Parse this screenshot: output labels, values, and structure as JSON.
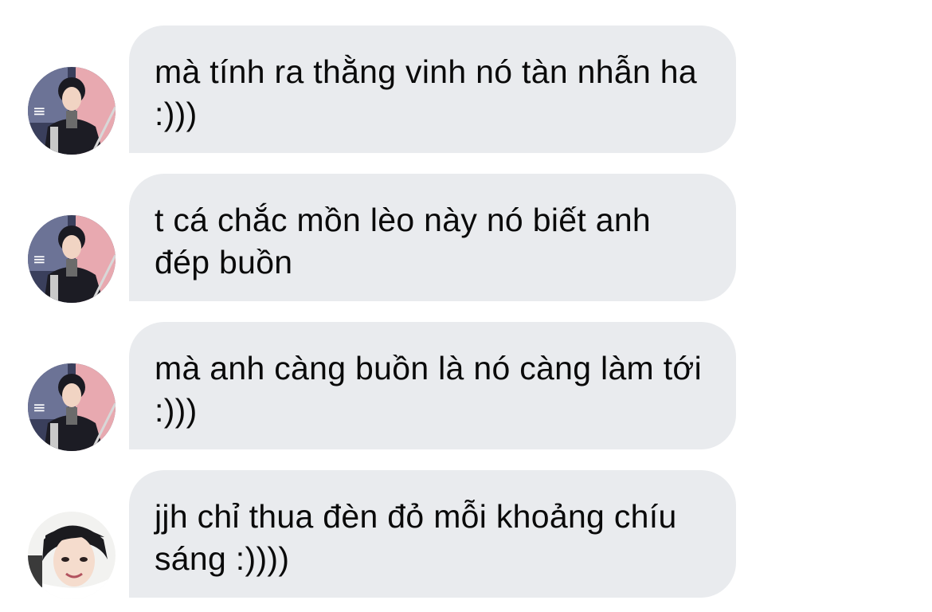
{
  "messages": [
    {
      "text": "mà tính ra thằng vinh nó tàn nhẫn ha :)))",
      "avatar": "sender-avatar-a"
    },
    {
      "text": "t cá chắc mồn lèo này nó biết anh đép buồn",
      "avatar": "sender-avatar-a"
    },
    {
      "text": "mà anh càng buồn là nó càng làm tới :)))",
      "avatar": "sender-avatar-a"
    },
    {
      "text": "jjh chỉ thua đèn đỏ mỗi khoảng chíu sáng :))))",
      "avatar": "sender-avatar-b"
    }
  ],
  "colors": {
    "bubble": "#e9ebee",
    "text": "#0a0a0a",
    "background": "#ffffff"
  }
}
